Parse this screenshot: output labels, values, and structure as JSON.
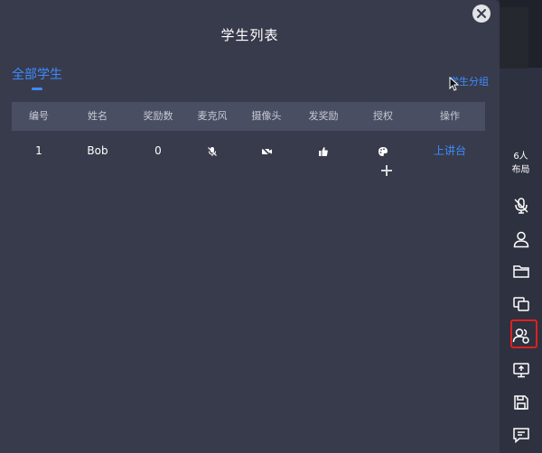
{
  "dialog": {
    "title": "学生列表",
    "tab_all": "全部学生",
    "group_link": "学生分组"
  },
  "table": {
    "headers": [
      "编号",
      "姓名",
      "奖励数",
      "麦克风",
      "摄像头",
      "发奖励",
      "授权",
      "操作"
    ],
    "rows": [
      {
        "id": "1",
        "name": "Bob",
        "rewards": "0",
        "mic_icon": "mic-off-icon",
        "camera_icon": "camera-off-icon",
        "reward_icon": "thumbs-up-icon",
        "auth_icon": "palette-icon",
        "action": "上讲台"
      }
    ]
  },
  "sidebar": {
    "layout_count": "6人",
    "layout_label": "布局",
    "tools": [
      "mic-off-icon",
      "user-icon",
      "folder-icon",
      "windows-icon",
      "user-group-icon",
      "screen-share-icon",
      "save-icon",
      "chat-icon"
    ]
  },
  "colors": {
    "accent": "#3d8bff",
    "dialog_bg": "#383b4c",
    "header_bg": "#4a4e63",
    "highlight": "#e02020"
  }
}
